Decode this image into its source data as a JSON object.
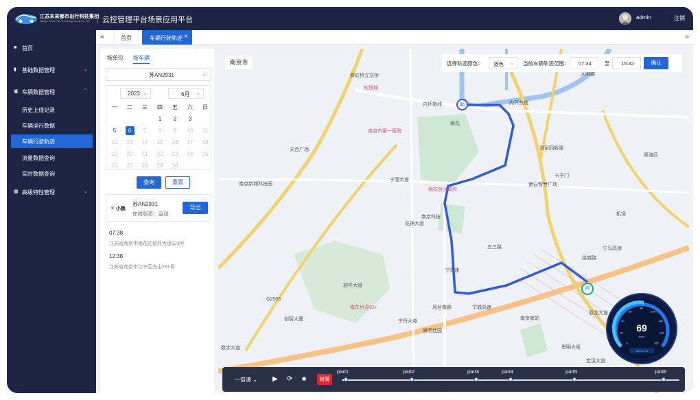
{
  "header": {
    "company_name": "江苏未来都市出行科技集团",
    "company_en": "Jiangsu Future City Technology Group Co.,LTD",
    "system_title": "云控管理平台场景应用平台",
    "username": "admin",
    "logout_label": "注销"
  },
  "sidebar": {
    "items": [
      {
        "label": "首页"
      },
      {
        "label": "基础数据管理"
      },
      {
        "label": "车辆数据管理"
      },
      {
        "label": "高级特性管理"
      }
    ],
    "sub_items": [
      {
        "label": "历史上线记录"
      },
      {
        "label": "车辆运行数据"
      },
      {
        "label": "车辆行驶轨迹"
      },
      {
        "label": "流量数据查询"
      },
      {
        "label": "实时数据查询"
      }
    ]
  },
  "tabs": {
    "home_label": "首页",
    "active_label": "车辆行驶轨迹"
  },
  "panel": {
    "seg_by_unit": "按单位",
    "seg_by_vehicle": "按车辆",
    "vehicle_select": "苏AN2931",
    "calendar": {
      "year": "2023",
      "month": "6月",
      "weekdays": [
        "一",
        "二",
        "三",
        "四",
        "五",
        "六",
        "日"
      ],
      "rows": [
        [
          "",
          "",
          "",
          "1",
          "2",
          "3",
          ""
        ],
        [
          "5",
          "6",
          "7",
          "8",
          "9",
          "10",
          "11"
        ],
        [
          "12",
          "13",
          "14",
          "15",
          "16",
          "17",
          "18"
        ],
        [
          "19",
          "20",
          "21",
          "22",
          "23",
          "24",
          "25"
        ],
        [
          "26",
          "27",
          "28",
          "29",
          "30",
          "",
          ""
        ]
      ],
      "selected_day": "6"
    },
    "query_label": "查询",
    "reset_label": "重置",
    "vehicle_card": {
      "brand": "小鹏",
      "plate": "苏AN2931",
      "status": "在线状态：运动",
      "export_label": "导出"
    },
    "records": [
      {
        "time": "07:38",
        "address": "江苏省南京市雨花区软件大道123号"
      },
      {
        "time": "12:38",
        "address": "江苏省南京市江宁区方山231号"
      }
    ]
  },
  "map": {
    "city": "南京市",
    "color_label": "选择轨迹颜色：",
    "color_value": "蓝色",
    "range_label": "当前车辆轨迹范围：",
    "start_time": "07:34",
    "to_label": "至",
    "end_time": "15:32",
    "confirm_label": "确认",
    "start_marker": "起",
    "end_marker": "终",
    "labels": [
      {
        "text": "赛虹桥立交桥"
      },
      {
        "text": "虹悦城"
      },
      {
        "text": "内环南线"
      },
      {
        "text": "内环东线"
      },
      {
        "text": "南京市第一医院"
      },
      {
        "text": "雨花"
      },
      {
        "text": "天合广场"
      },
      {
        "text": "洪家园新寓"
      },
      {
        "text": "南京新城科技园"
      },
      {
        "text": "雨花台区政府"
      },
      {
        "text": "紫云智慧广场"
      },
      {
        "text": "南京科技"
      },
      {
        "text": "花神大道"
      },
      {
        "text": "五三路"
      },
      {
        "text": "绕城路"
      },
      {
        "text": "宁高速"
      },
      {
        "text": "凤台南路"
      },
      {
        "text": "软件大道"
      },
      {
        "text": "南花世茂52+"
      },
      {
        "text": "宁丹大道"
      },
      {
        "text": "南京南站"
      },
      {
        "text": "景明佳园"
      },
      {
        "text": "景明大街"
      },
      {
        "text": "数字大道"
      },
      {
        "text": "双龙大道"
      },
      {
        "text": "宏运大道"
      },
      {
        "text": "机场"
      },
      {
        "text": "宁溧大道"
      },
      {
        "text": "大明路"
      },
      {
        "text": "秦淮区"
      },
      {
        "text": "宁马高速"
      },
      {
        "text": "宁城高速"
      },
      {
        "text": "G2503"
      },
      {
        "text": "创智大厦"
      },
      {
        "text": "卡子门"
      }
    ]
  },
  "player": {
    "speed_label": "一倍速",
    "alarm_label": "报警",
    "parts": [
      "part1",
      "part2",
      "part3",
      "part4",
      "part5",
      "part6"
    ]
  },
  "gauge": {
    "speed": "69",
    "unit": "km/h",
    "odometer": "15574 Km",
    "ticks": [
      "0",
      "20",
      "40",
      "60",
      "80",
      "100",
      "120",
      "140",
      "160"
    ]
  }
}
